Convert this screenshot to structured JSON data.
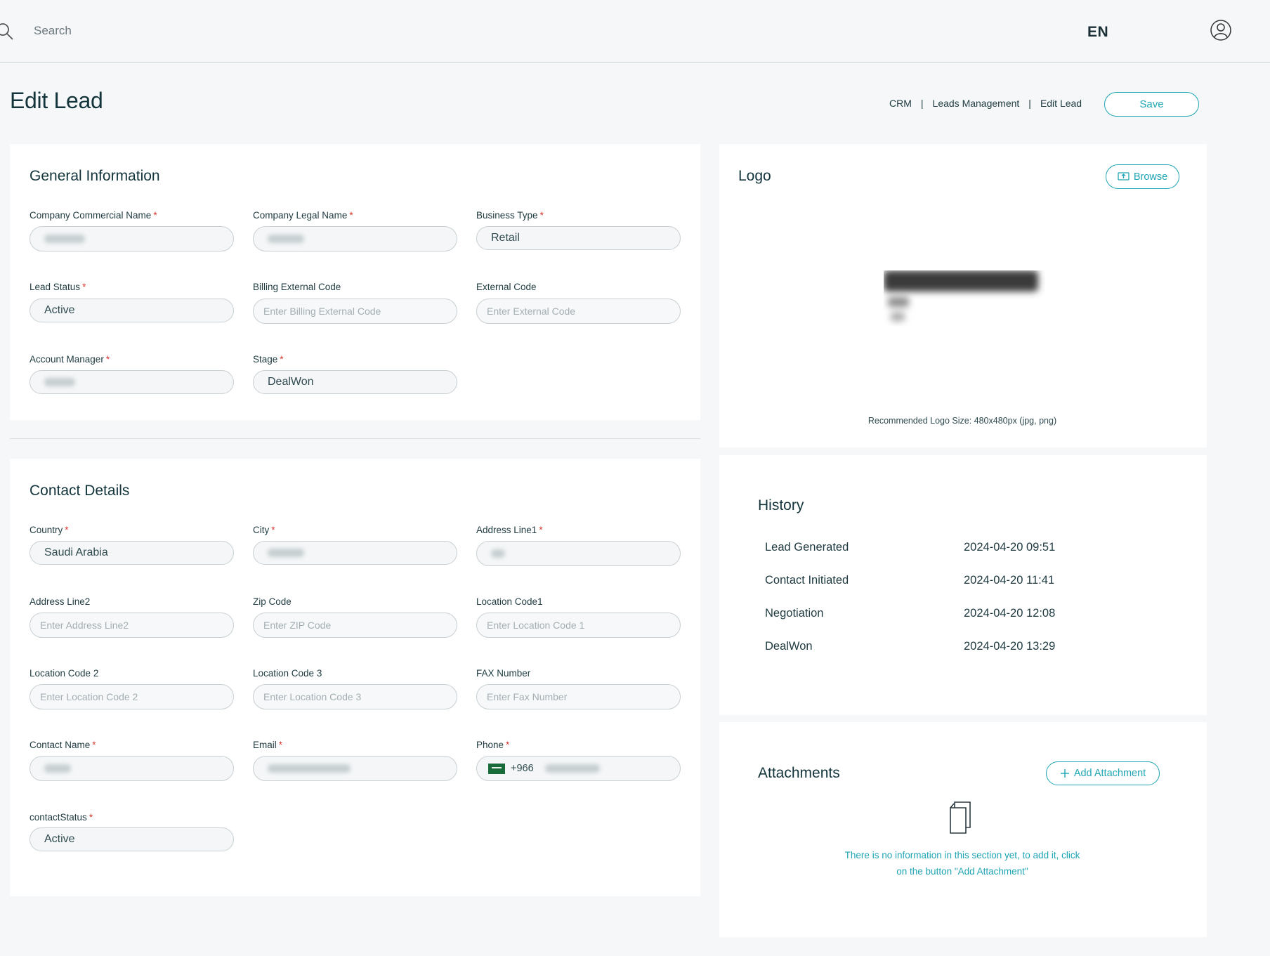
{
  "topbar": {
    "search_placeholder": "Search",
    "language": "EN"
  },
  "header": {
    "title": "Edit Lead",
    "breadcrumb": [
      "CRM",
      "Leads Management",
      "Edit Lead"
    ],
    "save_label": "Save"
  },
  "general": {
    "title": "General Information",
    "fields": {
      "company_commercial_name": {
        "label": "Company Commercial Name",
        "required": "*"
      },
      "company_legal_name": {
        "label": "Company Legal Name",
        "required": "*"
      },
      "business_type": {
        "label": "Business Type",
        "required": "*",
        "value": "Retail"
      },
      "lead_status": {
        "label": "Lead Status",
        "required": "*",
        "value": "Active"
      },
      "billing_external_code": {
        "label": "Billing External Code",
        "placeholder": "Enter Billing External Code"
      },
      "external_code": {
        "label": "External Code",
        "placeholder": "Enter External Code"
      },
      "account_manager": {
        "label": "Account Manager",
        "required": "*"
      },
      "stage": {
        "label": "Stage",
        "required": "*",
        "value": "DealWon"
      }
    }
  },
  "contact": {
    "title": "Contact Details",
    "fields": {
      "country": {
        "label": "Country",
        "required": "*",
        "value": "Saudi Arabia"
      },
      "city": {
        "label": "City",
        "required": "*"
      },
      "address_line1": {
        "label": "Address Line1",
        "required": "*"
      },
      "address_line2": {
        "label": "Address Line2",
        "placeholder": "Enter Address Line2"
      },
      "zip_code": {
        "label": "Zip Code",
        "placeholder": "Enter ZIP Code"
      },
      "location_code1": {
        "label": "Location Code1",
        "placeholder": "Enter Location Code 1"
      },
      "location_code2": {
        "label": "Location Code 2",
        "placeholder": "Enter Location Code 2"
      },
      "location_code3": {
        "label": "Location Code 3",
        "placeholder": "Enter Location Code 3"
      },
      "fax_number": {
        "label": "FAX Number",
        "placeholder": "Enter Fax Number"
      },
      "contact_name": {
        "label": "Contact Name",
        "required": "*"
      },
      "email": {
        "label": "Email",
        "required": "*"
      },
      "phone": {
        "label": "Phone",
        "required": "*",
        "prefix": "+966"
      },
      "contact_status": {
        "label": "contactStatus",
        "required": "*",
        "value": "Active"
      }
    }
  },
  "logo": {
    "title": "Logo",
    "browse_label": "Browse",
    "hint": "Recommended Logo Size: 480x480px (jpg, png)"
  },
  "history": {
    "title": "History",
    "rows": [
      {
        "event": "Lead Generated",
        "time": "2024-04-20 09:51"
      },
      {
        "event": "Contact Initiated",
        "time": "2024-04-20 11:41"
      },
      {
        "event": "Negotiation",
        "time": "2024-04-20 12:08"
      },
      {
        "event": "DealWon",
        "time": "2024-04-20 13:29"
      }
    ]
  },
  "attachments": {
    "title": "Attachments",
    "add_label": "Add Attachment",
    "empty_line1": "There is no information in this section yet, to add it, click",
    "empty_line2": "on the button \"Add Attachment\""
  },
  "colors": {
    "accent": "#1fa5b3",
    "required": "#d9342b",
    "title": "#13343b"
  }
}
